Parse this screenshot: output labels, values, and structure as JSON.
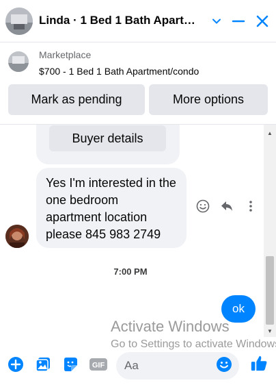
{
  "header": {
    "title": "Linda · 1 Bed 1 Bath Apart…",
    "accent": "#0084ff"
  },
  "marketplace": {
    "label": "Marketplace",
    "listing": "$700 - 1 Bed 1 Bath Apartment/condo",
    "mark_pending_label": "Mark as pending",
    "more_options_label": "More options"
  },
  "messages": {
    "buyer_details_label": "Buyer details",
    "incoming_text": "Yes I'm interested in the one bedroom apartment location please 845 983 2749",
    "timestamp": "7:00 PM",
    "outgoing_text": "ok"
  },
  "watermark": {
    "title": "Activate Windows",
    "subtitle": "Go to Settings to activate Windows."
  },
  "composer": {
    "placeholder": "Aa",
    "gif_label": "GIF"
  },
  "colors": {
    "accent": "#0084ff",
    "bubble_gray": "#f0f2f5",
    "button_gray": "#e4e6eb"
  }
}
